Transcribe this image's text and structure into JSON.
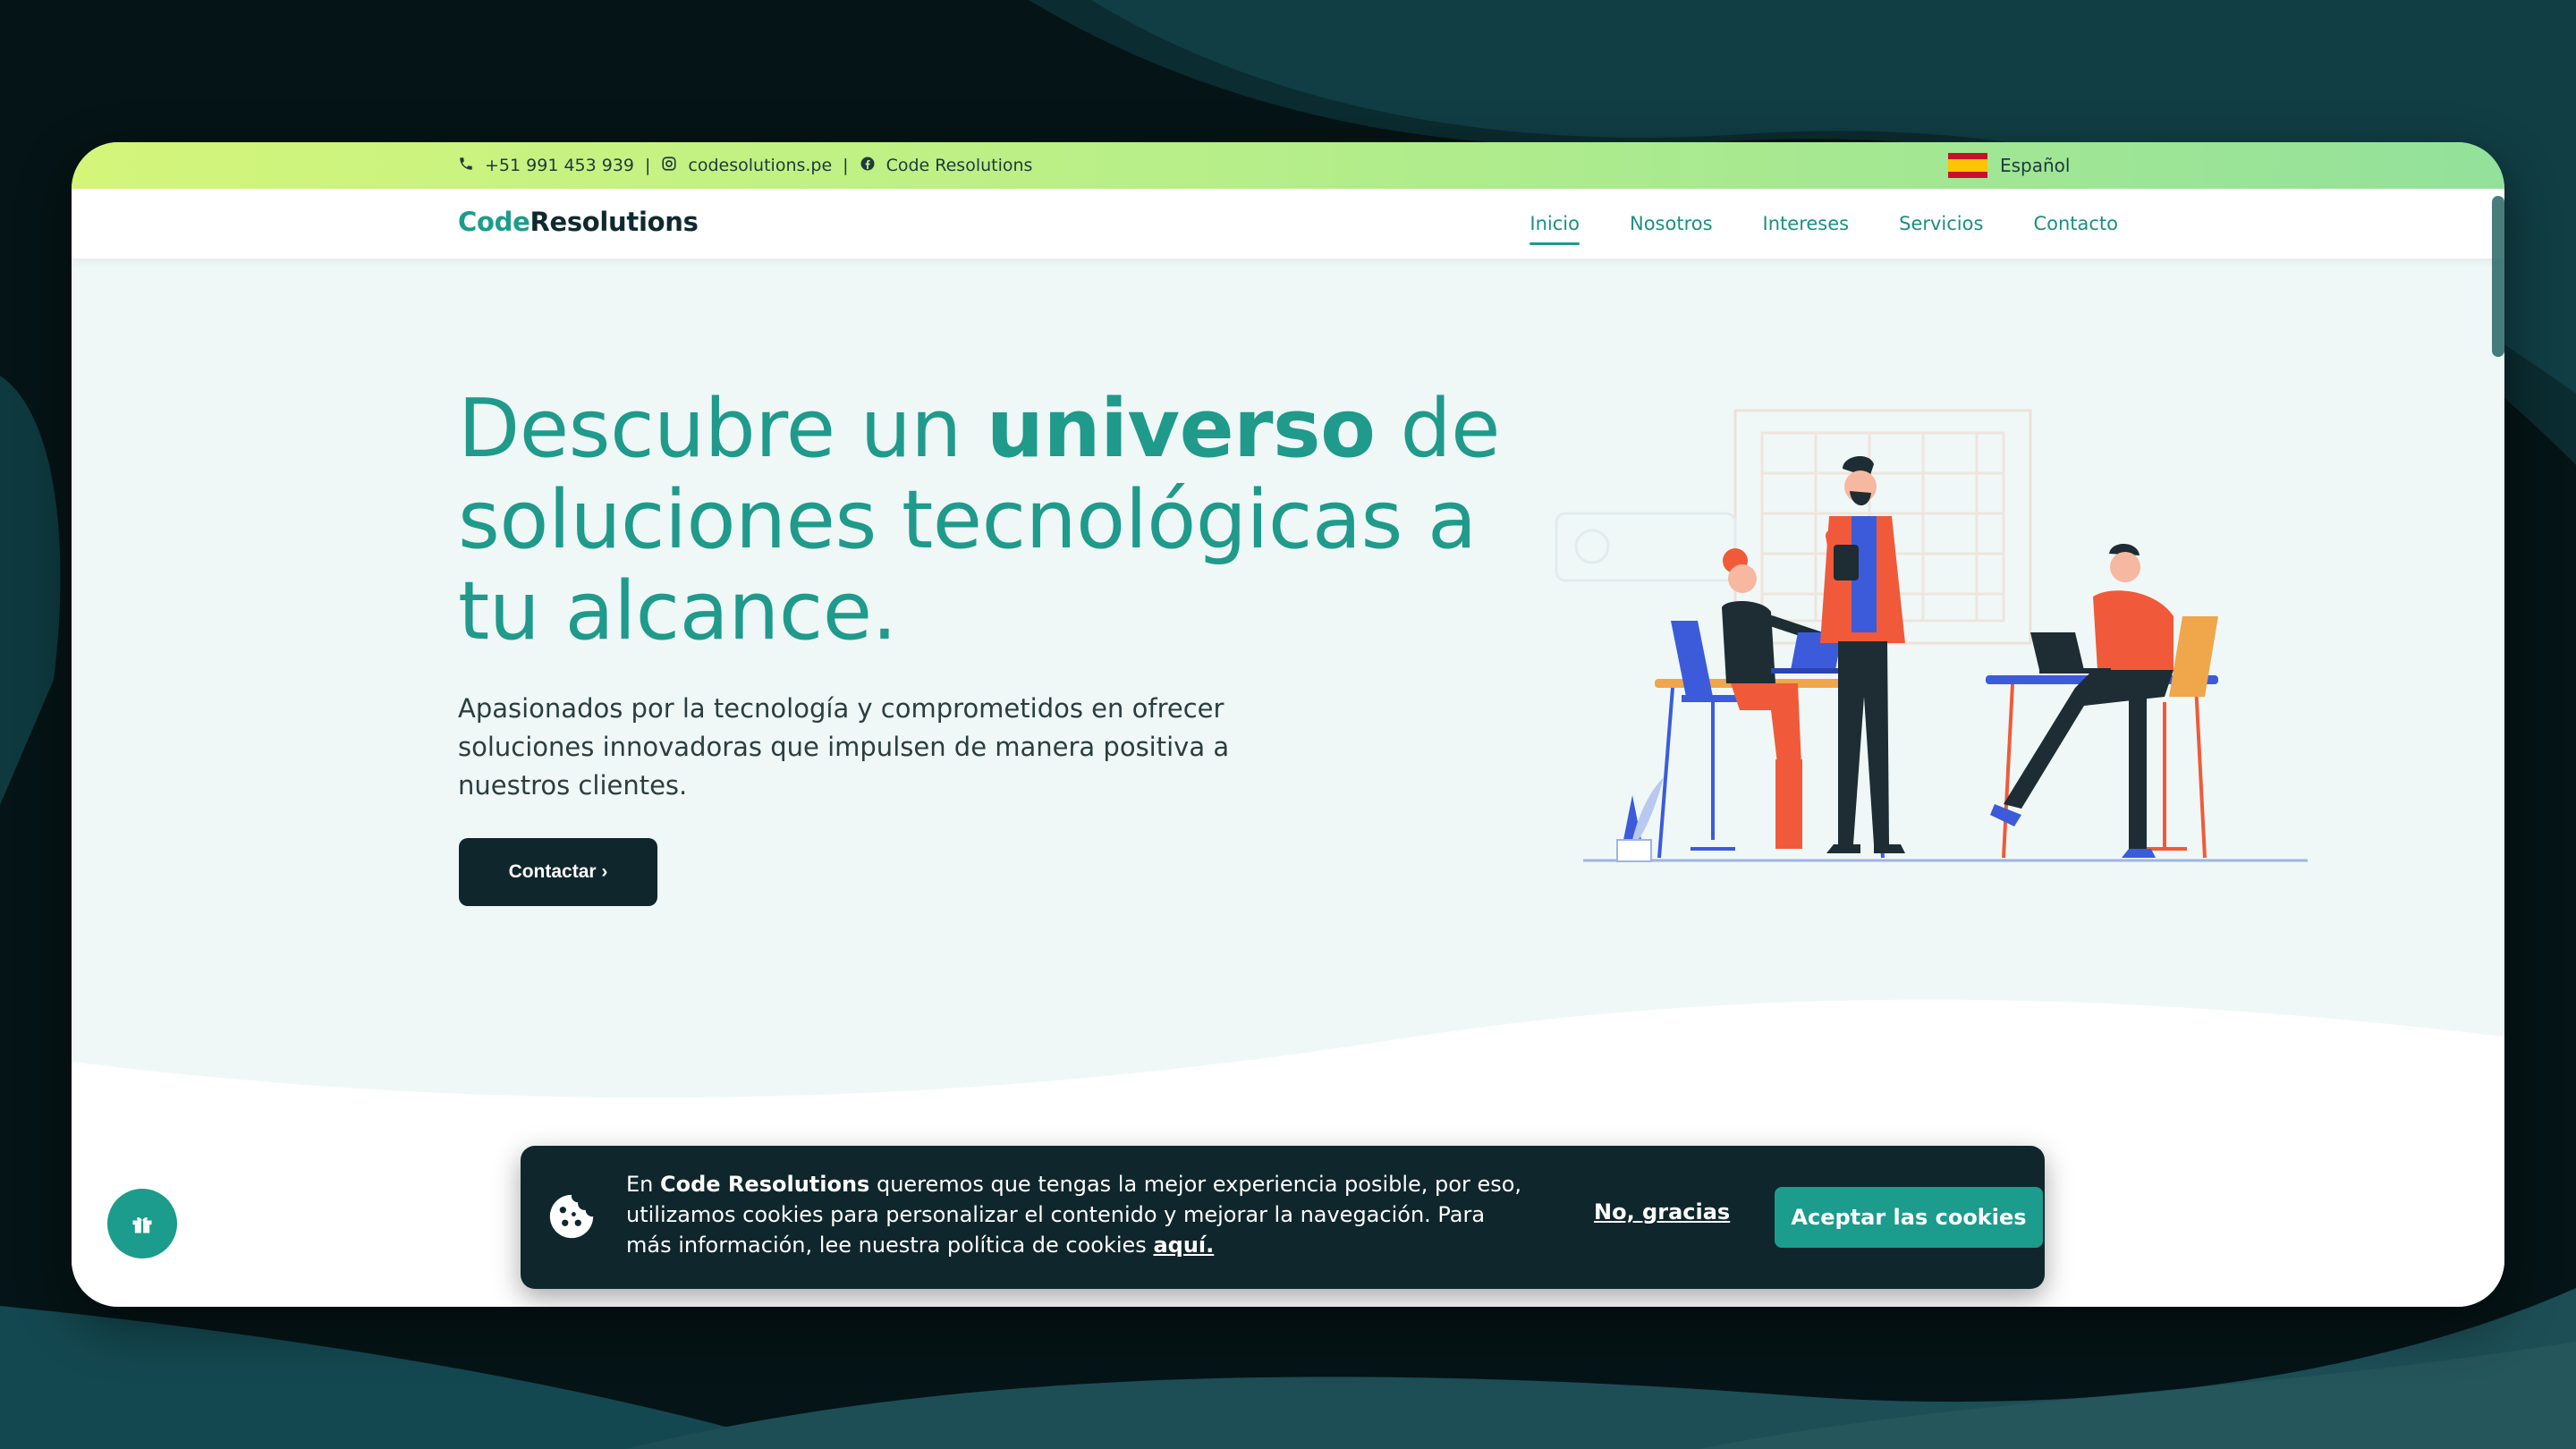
{
  "topbar": {
    "phone": "+51 991 453 939",
    "instagram": "codesolutions.pe",
    "facebook": "Code Resolutions",
    "language": "Español"
  },
  "navbar": {
    "logo_part1": "Code",
    "logo_part2": "Resolutions",
    "items": [
      {
        "label": "Inicio",
        "active": true
      },
      {
        "label": "Nosotros",
        "active": false
      },
      {
        "label": "Intereses",
        "active": false
      },
      {
        "label": "Servicios",
        "active": false
      },
      {
        "label": "Contacto",
        "active": false
      }
    ]
  },
  "hero": {
    "title_part1": "Descubre un ",
    "title_bold": "universo",
    "title_part2": " de soluciones tecnológicas a tu alcance.",
    "subtitle": "Apasionados por la tecnología y comprometidos en ofrecer soluciones innovadoras que impulsen de manera positiva a nuestros clientes.",
    "cta_label": "Contactar ›"
  },
  "cookie_banner": {
    "text_prefix": "En ",
    "brand": "Code Resolutions",
    "text_body": " queremos que tengas la mejor experiencia posible, por eso, utilizamos cookies para personalizar el contenido y mejorar la navegación. Para más información, lee nuestra política de cookies ",
    "link_label": "aquí.",
    "decline_label": "No, gracias",
    "accept_label": "Aceptar las cookies"
  },
  "icons": {
    "phone": "phone-icon",
    "instagram": "instagram-icon",
    "facebook": "facebook-icon",
    "flag": "spain-flag-icon",
    "gift": "gift-icon",
    "cookie": "cookie-icon"
  },
  "colors": {
    "accent": "#1b9c8c",
    "dark": "#0f262c",
    "hero_bg": "#eff8f7"
  }
}
